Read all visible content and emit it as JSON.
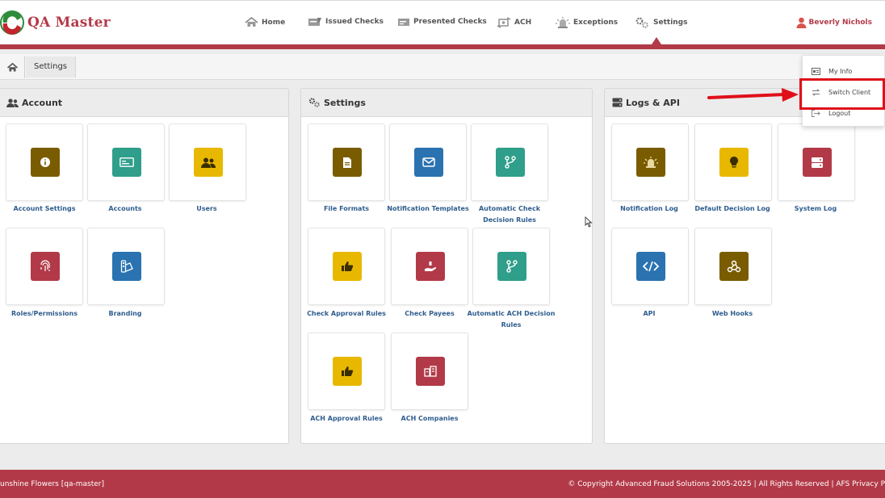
{
  "app": {
    "name": "QA Master"
  },
  "nav": [
    {
      "label": "Home",
      "icon": "home-icon"
    },
    {
      "label": "Issued Checks",
      "icon": "issued-checks-icon"
    },
    {
      "label": "Presented Checks",
      "icon": "presented-checks-icon"
    },
    {
      "label": "ACH",
      "icon": "ach-icon"
    },
    {
      "label": "Exceptions",
      "icon": "exceptions-icon"
    },
    {
      "label": "Settings",
      "icon": "gears-icon"
    }
  ],
  "user": {
    "name": "Beverly Nichols"
  },
  "breadcrumb": {
    "current": "Settings"
  },
  "panels": {
    "account": {
      "title": "Account",
      "tiles": [
        {
          "label": "Account Settings",
          "icon": "info-icon",
          "color": "#7a5c00"
        },
        {
          "label": "Accounts",
          "icon": "card-icon",
          "color": "#2f9e8a"
        },
        {
          "label": "Users",
          "icon": "users-icon",
          "color": "#e8b800"
        },
        {
          "label": "Roles/Permissions",
          "icon": "fingerprint-icon",
          "color": "#b23a48"
        },
        {
          "label": "Branding",
          "icon": "branding-icon",
          "color": "#2a73b0"
        }
      ]
    },
    "settings": {
      "title": "Settings",
      "tiles": [
        {
          "label": "File Formats",
          "icon": "file-icon",
          "color": "#7a5c00"
        },
        {
          "label": "Notification Templates",
          "icon": "envelope-icon",
          "color": "#2a73b0"
        },
        {
          "label": "Automatic Check Decision Rules",
          "icon": "branch-icon",
          "color": "#2f9e8a"
        },
        {
          "label": "Check Approval Rules",
          "icon": "thumbs-up-icon",
          "color": "#e8b800"
        },
        {
          "label": "Check Payees",
          "icon": "payee-icon",
          "color": "#b23a48"
        },
        {
          "label": "Automatic ACH Decision Rules",
          "icon": "branch-icon",
          "color": "#2f9e8a"
        },
        {
          "label": "ACH Approval Rules",
          "icon": "thumbs-up-icon",
          "color": "#e8b800"
        },
        {
          "label": "ACH Companies",
          "icon": "companies-icon",
          "color": "#b23a48"
        }
      ]
    },
    "logs": {
      "title": "Logs & API",
      "tiles": [
        {
          "label": "Notification Log",
          "icon": "alarm-icon",
          "color": "#7a5c00"
        },
        {
          "label": "Default Decision Log",
          "icon": "lightbulb-icon",
          "color": "#e8b800"
        },
        {
          "label": "System Log",
          "icon": "server-icon",
          "color": "#b23a48"
        },
        {
          "label": "API",
          "icon": "code-icon",
          "color": "#2a73b0"
        },
        {
          "label": "Web Hooks",
          "icon": "webhook-icon",
          "color": "#7a5c00"
        }
      ]
    }
  },
  "dropdown": [
    {
      "label": "My Info",
      "icon": "id-card-icon"
    },
    {
      "label": "Switch Client",
      "icon": "switch-icon"
    },
    {
      "label": "Logout",
      "icon": "logout-icon"
    }
  ],
  "footer": {
    "left": "unshine Flowers  [qa-master]",
    "right": "© Copyright Advanced Fraud Solutions 2005-2025  |   All Rights Reserved   |   AFS Privacy P"
  },
  "colors": {
    "brand": "#b23a48",
    "link": "#2f5d8e",
    "highlight": "#e0101a"
  }
}
